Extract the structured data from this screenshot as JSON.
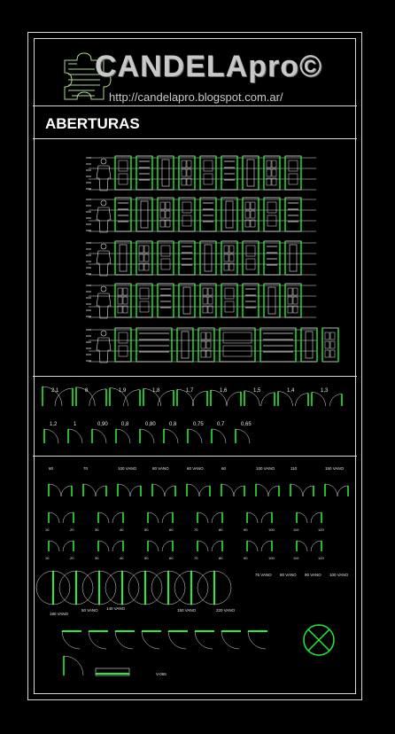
{
  "header": {
    "brand": "CANDELApro©",
    "url": "http://candelapro.blogspot.com.ar/"
  },
  "section_title": "ABERTURAS",
  "colors": {
    "background": "#000000",
    "frame": "#d8d8d8",
    "symbol_green": "#22ee33",
    "symbol_white": "#e6e6e6"
  },
  "icons": [
    "puzzle-logo-icon"
  ],
  "swing_labels_row1": [
    "2,1",
    "8",
    "1,9",
    "1,8",
    "1,7",
    "1,6",
    "1,5",
    "1,4",
    "1,3"
  ],
  "swing_labels_row2": [
    "1,2",
    "1",
    "0,90",
    "0,8",
    "0,80",
    "0,8",
    "0,75",
    "0,7",
    "0,65"
  ],
  "window_labels_row": [
    "60",
    "70",
    "100 VANO",
    "80 VANO",
    "60 VANO",
    "60",
    "100 VANO",
    "110",
    "150 VANO"
  ],
  "sliding_labels": [
    "75 VANO",
    "80 VANO",
    "90 VANO",
    "100 VANO"
  ],
  "bottom_labels": [
    "180 VANO",
    "50 VANO",
    "140 VANO",
    "200 VANO",
    "150 VANO",
    "220 VANO",
    "V-065"
  ]
}
